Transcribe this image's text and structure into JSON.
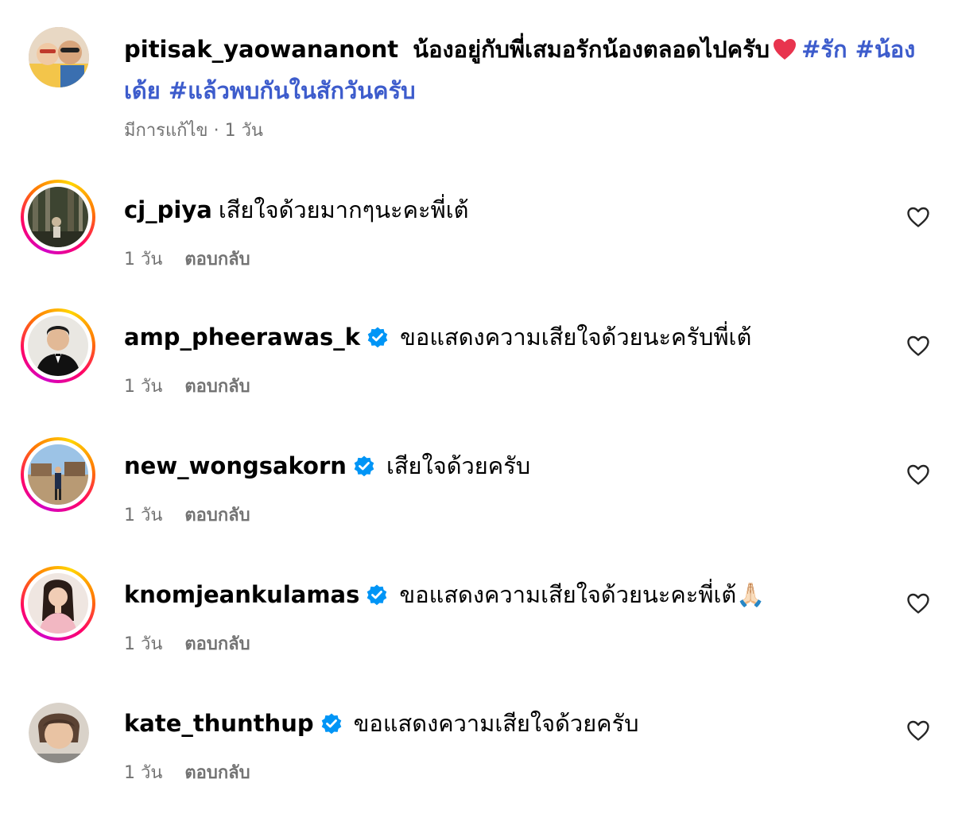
{
  "caption": {
    "username": "pitisak_yaowananont",
    "text": "น้องอยู่กับพี่เสมอรักน้องตลอดไปครับ",
    "emoji": "heart",
    "tags": [
      "#รัก",
      "#น้องเด้ย",
      "#แล้วพบกันในสักวันครับ"
    ],
    "meta": "มีการแก้ไข · 1 วัน"
  },
  "comments": [
    {
      "username": "cj_piya",
      "verified": false,
      "text": "เสียใจด้วยมากๆนะคะพี่เต้",
      "time": "1 วัน",
      "reply": "ตอบกลับ"
    },
    {
      "username": "amp_pheerawas_k",
      "verified": true,
      "text": "ขอแสดงความเสียใจด้วยนะครับพี่เต้",
      "time": "1 วัน",
      "reply": "ตอบกลับ"
    },
    {
      "username": "new_wongsakorn",
      "verified": true,
      "text": "เสียใจด้วยครับ",
      "time": "1 วัน",
      "reply": "ตอบกลับ"
    },
    {
      "username": "knomjeankulamas",
      "verified": true,
      "text": "ขอแสดงความเสียใจด้วยนะคะพี่เต้🙏🏻",
      "time": "1 วัน",
      "reply": "ตอบกลับ"
    },
    {
      "username": "kate_thunthup",
      "verified": true,
      "text": "ขอแสดงความเสียใจด้วยครับ",
      "time": "1 วัน",
      "reply": "ตอบกลับ"
    }
  ],
  "colors": {
    "hashtag": "#3d5ccc",
    "verified": "#0095f6",
    "meta": "#737373"
  }
}
